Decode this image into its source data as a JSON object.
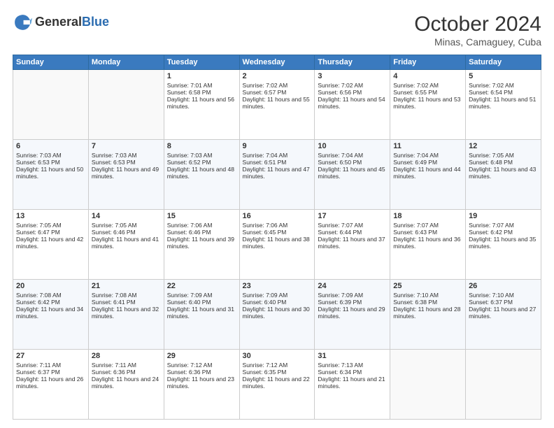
{
  "header": {
    "logo_general": "General",
    "logo_blue": "Blue",
    "month_year": "October 2024",
    "location": "Minas, Camaguey, Cuba"
  },
  "weekdays": [
    "Sunday",
    "Monday",
    "Tuesday",
    "Wednesday",
    "Thursday",
    "Friday",
    "Saturday"
  ],
  "weeks": [
    [
      {
        "day": "",
        "sunrise": "",
        "sunset": "",
        "daylight": ""
      },
      {
        "day": "",
        "sunrise": "",
        "sunset": "",
        "daylight": ""
      },
      {
        "day": "1",
        "sunrise": "Sunrise: 7:01 AM",
        "sunset": "Sunset: 6:58 PM",
        "daylight": "Daylight: 11 hours and 56 minutes."
      },
      {
        "day": "2",
        "sunrise": "Sunrise: 7:02 AM",
        "sunset": "Sunset: 6:57 PM",
        "daylight": "Daylight: 11 hours and 55 minutes."
      },
      {
        "day": "3",
        "sunrise": "Sunrise: 7:02 AM",
        "sunset": "Sunset: 6:56 PM",
        "daylight": "Daylight: 11 hours and 54 minutes."
      },
      {
        "day": "4",
        "sunrise": "Sunrise: 7:02 AM",
        "sunset": "Sunset: 6:55 PM",
        "daylight": "Daylight: 11 hours and 53 minutes."
      },
      {
        "day": "5",
        "sunrise": "Sunrise: 7:02 AM",
        "sunset": "Sunset: 6:54 PM",
        "daylight": "Daylight: 11 hours and 51 minutes."
      }
    ],
    [
      {
        "day": "6",
        "sunrise": "Sunrise: 7:03 AM",
        "sunset": "Sunset: 6:53 PM",
        "daylight": "Daylight: 11 hours and 50 minutes."
      },
      {
        "day": "7",
        "sunrise": "Sunrise: 7:03 AM",
        "sunset": "Sunset: 6:53 PM",
        "daylight": "Daylight: 11 hours and 49 minutes."
      },
      {
        "day": "8",
        "sunrise": "Sunrise: 7:03 AM",
        "sunset": "Sunset: 6:52 PM",
        "daylight": "Daylight: 11 hours and 48 minutes."
      },
      {
        "day": "9",
        "sunrise": "Sunrise: 7:04 AM",
        "sunset": "Sunset: 6:51 PM",
        "daylight": "Daylight: 11 hours and 47 minutes."
      },
      {
        "day": "10",
        "sunrise": "Sunrise: 7:04 AM",
        "sunset": "Sunset: 6:50 PM",
        "daylight": "Daylight: 11 hours and 45 minutes."
      },
      {
        "day": "11",
        "sunrise": "Sunrise: 7:04 AM",
        "sunset": "Sunset: 6:49 PM",
        "daylight": "Daylight: 11 hours and 44 minutes."
      },
      {
        "day": "12",
        "sunrise": "Sunrise: 7:05 AM",
        "sunset": "Sunset: 6:48 PM",
        "daylight": "Daylight: 11 hours and 43 minutes."
      }
    ],
    [
      {
        "day": "13",
        "sunrise": "Sunrise: 7:05 AM",
        "sunset": "Sunset: 6:47 PM",
        "daylight": "Daylight: 11 hours and 42 minutes."
      },
      {
        "day": "14",
        "sunrise": "Sunrise: 7:05 AM",
        "sunset": "Sunset: 6:46 PM",
        "daylight": "Daylight: 11 hours and 41 minutes."
      },
      {
        "day": "15",
        "sunrise": "Sunrise: 7:06 AM",
        "sunset": "Sunset: 6:46 PM",
        "daylight": "Daylight: 11 hours and 39 minutes."
      },
      {
        "day": "16",
        "sunrise": "Sunrise: 7:06 AM",
        "sunset": "Sunset: 6:45 PM",
        "daylight": "Daylight: 11 hours and 38 minutes."
      },
      {
        "day": "17",
        "sunrise": "Sunrise: 7:07 AM",
        "sunset": "Sunset: 6:44 PM",
        "daylight": "Daylight: 11 hours and 37 minutes."
      },
      {
        "day": "18",
        "sunrise": "Sunrise: 7:07 AM",
        "sunset": "Sunset: 6:43 PM",
        "daylight": "Daylight: 11 hours and 36 minutes."
      },
      {
        "day": "19",
        "sunrise": "Sunrise: 7:07 AM",
        "sunset": "Sunset: 6:42 PM",
        "daylight": "Daylight: 11 hours and 35 minutes."
      }
    ],
    [
      {
        "day": "20",
        "sunrise": "Sunrise: 7:08 AM",
        "sunset": "Sunset: 6:42 PM",
        "daylight": "Daylight: 11 hours and 34 minutes."
      },
      {
        "day": "21",
        "sunrise": "Sunrise: 7:08 AM",
        "sunset": "Sunset: 6:41 PM",
        "daylight": "Daylight: 11 hours and 32 minutes."
      },
      {
        "day": "22",
        "sunrise": "Sunrise: 7:09 AM",
        "sunset": "Sunset: 6:40 PM",
        "daylight": "Daylight: 11 hours and 31 minutes."
      },
      {
        "day": "23",
        "sunrise": "Sunrise: 7:09 AM",
        "sunset": "Sunset: 6:40 PM",
        "daylight": "Daylight: 11 hours and 30 minutes."
      },
      {
        "day": "24",
        "sunrise": "Sunrise: 7:09 AM",
        "sunset": "Sunset: 6:39 PM",
        "daylight": "Daylight: 11 hours and 29 minutes."
      },
      {
        "day": "25",
        "sunrise": "Sunrise: 7:10 AM",
        "sunset": "Sunset: 6:38 PM",
        "daylight": "Daylight: 11 hours and 28 minutes."
      },
      {
        "day": "26",
        "sunrise": "Sunrise: 7:10 AM",
        "sunset": "Sunset: 6:37 PM",
        "daylight": "Daylight: 11 hours and 27 minutes."
      }
    ],
    [
      {
        "day": "27",
        "sunrise": "Sunrise: 7:11 AM",
        "sunset": "Sunset: 6:37 PM",
        "daylight": "Daylight: 11 hours and 26 minutes."
      },
      {
        "day": "28",
        "sunrise": "Sunrise: 7:11 AM",
        "sunset": "Sunset: 6:36 PM",
        "daylight": "Daylight: 11 hours and 24 minutes."
      },
      {
        "day": "29",
        "sunrise": "Sunrise: 7:12 AM",
        "sunset": "Sunset: 6:36 PM",
        "daylight": "Daylight: 11 hours and 23 minutes."
      },
      {
        "day": "30",
        "sunrise": "Sunrise: 7:12 AM",
        "sunset": "Sunset: 6:35 PM",
        "daylight": "Daylight: 11 hours and 22 minutes."
      },
      {
        "day": "31",
        "sunrise": "Sunrise: 7:13 AM",
        "sunset": "Sunset: 6:34 PM",
        "daylight": "Daylight: 11 hours and 21 minutes."
      },
      {
        "day": "",
        "sunrise": "",
        "sunset": "",
        "daylight": ""
      },
      {
        "day": "",
        "sunrise": "",
        "sunset": "",
        "daylight": ""
      }
    ]
  ]
}
